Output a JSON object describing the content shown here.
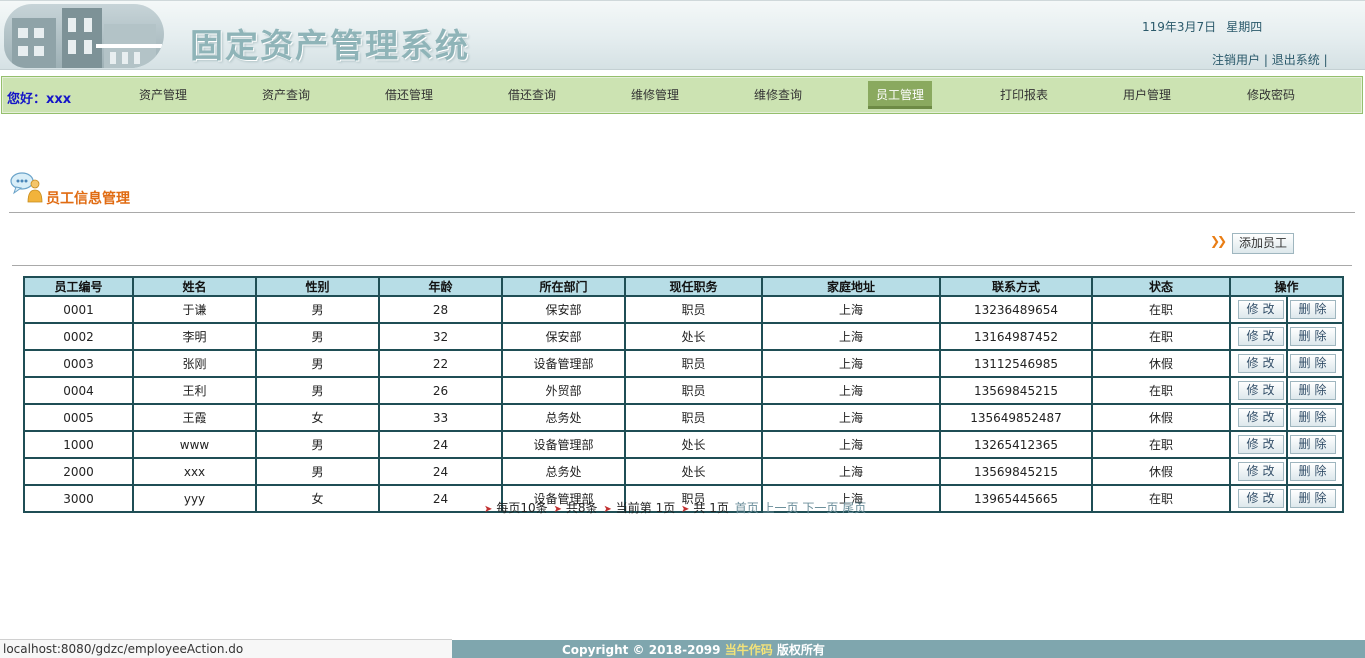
{
  "header": {
    "title": "固定资产管理系统",
    "date": "119年3月7日",
    "weekday": "星期四",
    "logout_user": "注销用户",
    "sep": "|",
    "exit_system": "退出系统",
    "sep_end": "|"
  },
  "nav": {
    "greeting": "您好：xxx",
    "items": [
      "资产管理",
      "资产查询",
      "借还管理",
      "借还查询",
      "维修管理",
      "维修查询",
      "员工管理",
      "打印报表",
      "用户管理",
      "修改密码"
    ],
    "active_index": 6
  },
  "section": {
    "title": "员工信息管理",
    "add_button": "添加员工"
  },
  "table": {
    "columns": [
      "员工编号",
      "姓名",
      "性别",
      "年龄",
      "所在部门",
      "现任职务",
      "家庭地址",
      "联系方式",
      "状态",
      "操作"
    ],
    "edit_label": "修改",
    "delete_label": "删除",
    "rows": [
      [
        "0001",
        "于谦",
        "男",
        "28",
        "保安部",
        "职员",
        "上海",
        "13236489654",
        "在职"
      ],
      [
        "0002",
        "李明",
        "男",
        "32",
        "保安部",
        "处长",
        "上海",
        "13164987452",
        "在职"
      ],
      [
        "0003",
        "张刚",
        "男",
        "22",
        "设备管理部",
        "职员",
        "上海",
        "13112546985",
        "休假"
      ],
      [
        "0004",
        "王利",
        "男",
        "26",
        "外贸部",
        "职员",
        "上海",
        "13569845215",
        "在职"
      ],
      [
        "0005",
        "王霞",
        "女",
        "33",
        "总务处",
        "职员",
        "上海",
        "135649852487",
        "休假"
      ],
      [
        "1000",
        "www",
        "男",
        "24",
        "设备管理部",
        "处长",
        "上海",
        "13265412365",
        "在职"
      ],
      [
        "2000",
        "xxx",
        "男",
        "24",
        "总务处",
        "处长",
        "上海",
        "13569845215",
        "休假"
      ],
      [
        "3000",
        "yyy",
        "女",
        "24",
        "设备管理部",
        "职员",
        "上海",
        "13965445665",
        "在职"
      ]
    ]
  },
  "pager": {
    "per_page": "每页10条",
    "total": "共8条",
    "current": "当前第 1页",
    "pages": "共 1页",
    "first": "首页",
    "prev": "上一页",
    "next": "下一页",
    "last": "尾页"
  },
  "footer": {
    "status_url": "localhost:8080/gdzc/employeeAction.do",
    "copyright": "Copyright © 2018-2099 ",
    "author": "当牛作码",
    "rights": " 版权所有"
  },
  "colors": {
    "nav_bg": "#cce3b2",
    "active_tab": "#8aa95f",
    "table_header": "#b7dde6",
    "table_border": "#1f4e55",
    "section_title": "#e06b12",
    "greeting": "#1515c8",
    "footer_bg": "#7fa6ae"
  }
}
